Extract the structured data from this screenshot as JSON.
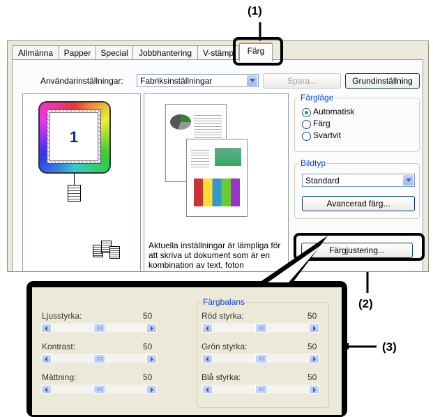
{
  "callouts": [
    "(1)",
    "(2)",
    "(3)"
  ],
  "tabs": [
    "Allmänna",
    "Papper",
    "Special",
    "Jobbhantering",
    "V-stämp",
    "Färg"
  ],
  "active_tab": "Färg",
  "user_settings": {
    "label": "Användarinställningar:",
    "value": "Fabriksinställningar",
    "save": "Spara...",
    "default": "Grundinställning"
  },
  "preview_page_number": "1",
  "description": "Aktuella inställningar är lämpliga för att skriva ut dokument som är en kombination av text, foton",
  "color_mode": {
    "title": "Färgläge",
    "options": [
      "Automatisk",
      "Färg",
      "Svartvit"
    ],
    "selected": "Automatisk"
  },
  "image_type": {
    "title": "Bildtyp",
    "value": "Standard",
    "advanced": "Avancerad färg..."
  },
  "color_adjust_button": "Färgjustering...",
  "adjust": {
    "left": [
      {
        "label": "Ljusstyrka:",
        "value": "50"
      },
      {
        "label": "Kontrast:",
        "value": "50"
      },
      {
        "label": "Mättning:",
        "value": "50"
      }
    ],
    "balance_title": "Färgbalans",
    "right": [
      {
        "label": "Röd styrka:",
        "value": "50"
      },
      {
        "label": "Grön styrka:",
        "value": "50"
      },
      {
        "label": "Blå styrka:",
        "value": "50"
      }
    ]
  },
  "colors": {
    "accent_tab": "#e68b2c",
    "radio_dot": "#21a121",
    "group_title": "#0046d5"
  }
}
